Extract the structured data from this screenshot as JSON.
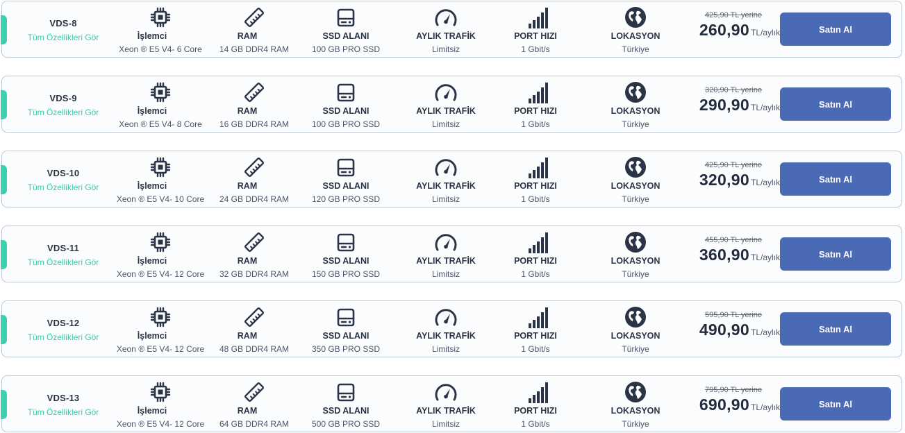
{
  "colors": {
    "accent": "#3ecfb0",
    "button": "#4a6ab5",
    "text_dark": "#2b3446",
    "link": "#3ec9a7",
    "border": "#b9c7d6"
  },
  "icons": {
    "cpu": "cpu-icon",
    "ram": "ram-stick-icon",
    "ssd": "hard-drive-icon",
    "traffic": "speedometer-icon",
    "port": "signal-bars-icon",
    "location": "globe-icon"
  },
  "labels": {
    "details_link": "Tüm Özellikleri Gör",
    "cpu": "İşlemci",
    "ram": "RAM",
    "ssd": "SSD ALANI",
    "traffic": "AYLIK TRAFİK",
    "port": "PORT HIZI",
    "location": "LOKASYON",
    "unit": "TL/aylık",
    "buy": "Satın Al"
  },
  "plans": [
    {
      "name": "VDS-8",
      "cpu": "Xeon ® E5 V4- 6 Core",
      "ram": "14 GB DDR4 RAM",
      "ssd": "100 GB PRO SSD",
      "traffic": "Limitsiz",
      "port": "1 Gbit/s",
      "location": "Türkiye",
      "old_price": "425,90 TL yerine",
      "price": "260,90"
    },
    {
      "name": "VDS-9",
      "cpu": "Xeon ® E5 V4- 8 Core",
      "ram": "16 GB DDR4 RAM",
      "ssd": "100 GB PRO SSD",
      "traffic": "Limitsiz",
      "port": "1 Gbit/s",
      "location": "Türkiye",
      "old_price": "320,90 TL yerine",
      "price": "290,90"
    },
    {
      "name": "VDS-10",
      "cpu": "Xeon ® E5 V4- 10 Core",
      "ram": "24 GB DDR4 RAM",
      "ssd": "120 GB PRO SSD",
      "traffic": "Limitsiz",
      "port": "1 Gbit/s",
      "location": "Türkiye",
      "old_price": "425,90 TL yerine",
      "price": "320,90"
    },
    {
      "name": "VDS-11",
      "cpu": "Xeon ® E5 V4- 12 Core",
      "ram": "32 GB DDR4 RAM",
      "ssd": "150 GB PRO SSD",
      "traffic": "Limitsiz",
      "port": "1 Gbit/s",
      "location": "Türkiye",
      "old_price": "455,90 TL yerine",
      "price": "360,90"
    },
    {
      "name": "VDS-12",
      "cpu": "Xeon ® E5 V4- 12 Core",
      "ram": "48 GB DDR4 RAM",
      "ssd": "350 GB PRO SSD",
      "traffic": "Limitsiz",
      "port": "1 Gbit/s",
      "location": "Türkiye",
      "old_price": "595,90 TL yerine",
      "price": "490,90"
    },
    {
      "name": "VDS-13",
      "cpu": "Xeon ® E5 V4- 12 Core",
      "ram": "64 GB DDR4 RAM",
      "ssd": "500 GB PRO SSD",
      "traffic": "Limitsiz",
      "port": "1 Gbit/s",
      "location": "Türkiye",
      "old_price": "795,90 TL yerine",
      "price": "690,90"
    }
  ]
}
